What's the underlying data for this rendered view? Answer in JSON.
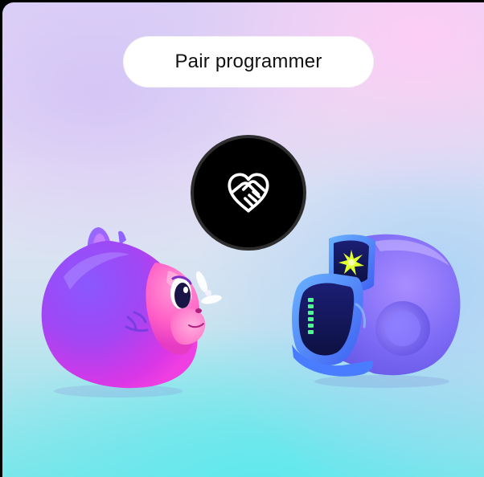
{
  "card": {
    "title": "Pair programmer",
    "badge_icon": "heart-handshake-icon",
    "left_character": "pink-creature-illustration",
    "right_character": "robot-helmet-illustration"
  },
  "colors": {
    "badge_background": "#000000",
    "pill_background": "#ffffff",
    "accent_pink": "#ff4fd8",
    "accent_purple": "#7a4cf0",
    "accent_lime": "#d8ff2a"
  }
}
